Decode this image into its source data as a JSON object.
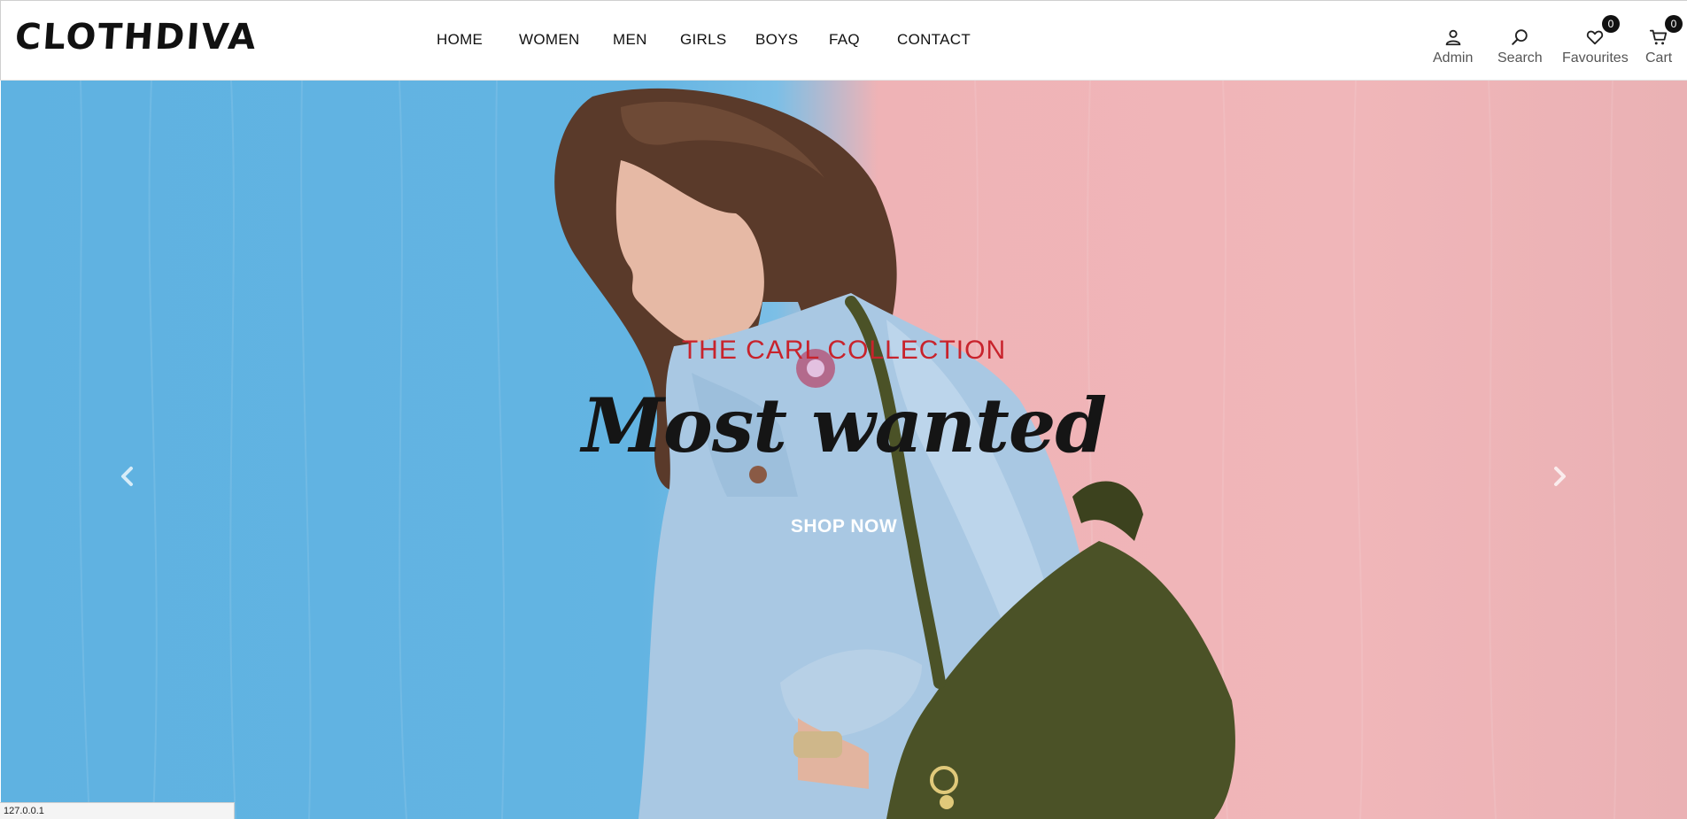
{
  "brand": {
    "logo": "CLOTHDIVA"
  },
  "nav": {
    "items": [
      {
        "label": "HOME"
      },
      {
        "label": "WOMEN"
      },
      {
        "label": "MEN"
      },
      {
        "label": "GIRLS"
      },
      {
        "label": "BOYS"
      },
      {
        "label": "FAQ"
      },
      {
        "label": "CONTACT"
      }
    ]
  },
  "actions": {
    "admin": {
      "label": "Admin",
      "icon": "user-icon"
    },
    "search": {
      "label": "Search",
      "icon": "search-icon"
    },
    "favourites": {
      "label": "Favourites",
      "icon": "heart-icon",
      "count": "0"
    },
    "cart": {
      "label": "Cart",
      "icon": "cart-icon",
      "count": "0"
    }
  },
  "hero": {
    "collection": "THE CARL COLLECTION",
    "headline": "Most wanted",
    "cta": "SHOP NOW",
    "prev_icon": "chevron-left-icon",
    "next_icon": "chevron-right-icon"
  },
  "statusbar": {
    "url": "127.0.0.1"
  },
  "colors": {
    "accent_red": "#c8232c",
    "sky_blue": "#63b4e2",
    "wall_pink": "#f0b6b9",
    "bag_olive": "#4b5227",
    "denim": "#a9c8e3"
  }
}
